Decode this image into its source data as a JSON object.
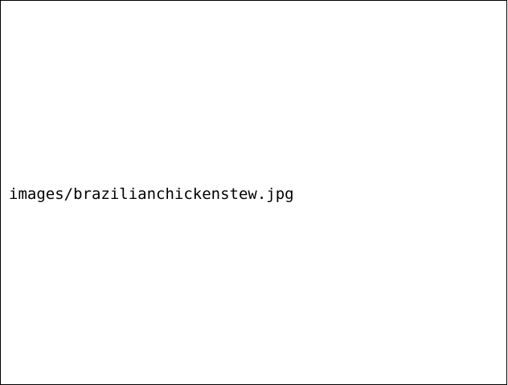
{
  "image_placeholder": {
    "filename": "images/brazilianchickenstew.jpg"
  }
}
